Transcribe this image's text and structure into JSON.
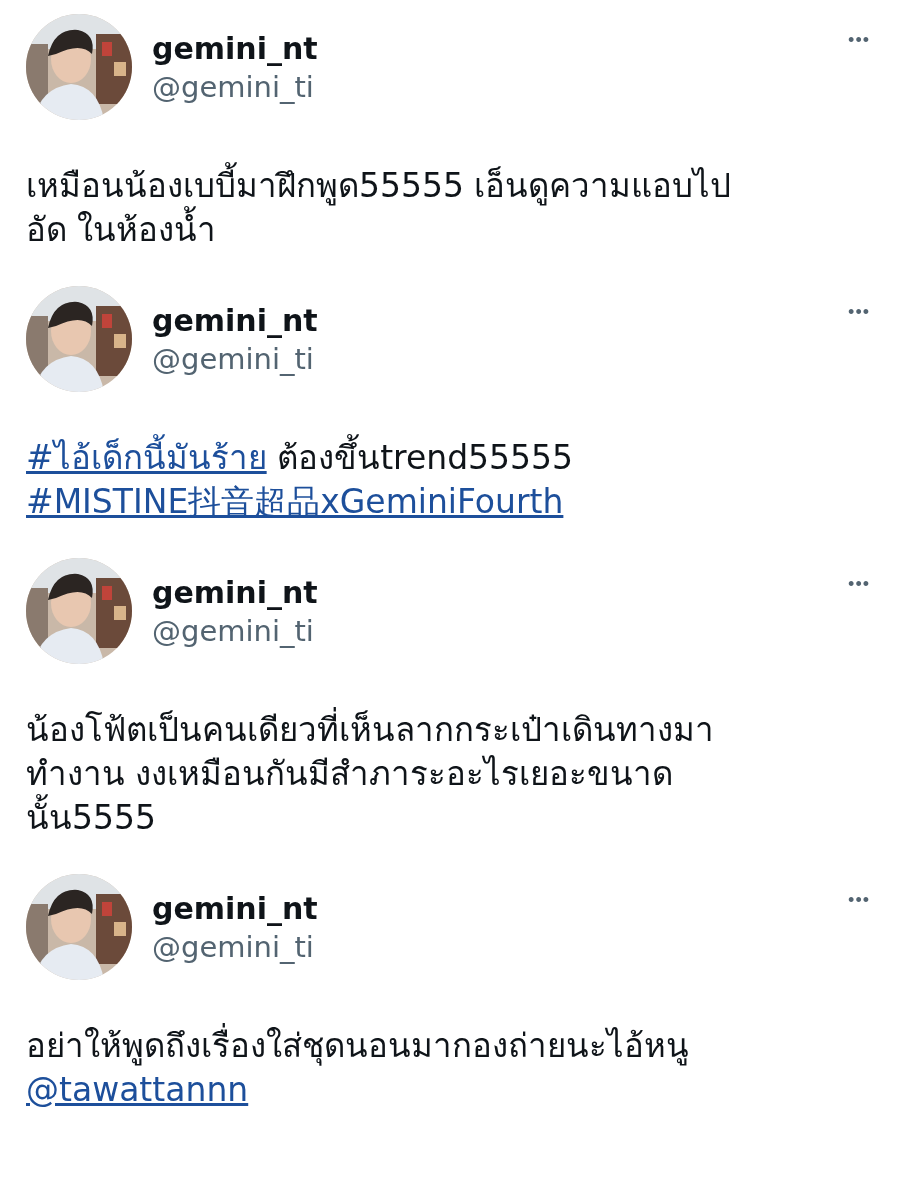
{
  "tweets": [
    {
      "name": "gemini_nt",
      "handle": "@gemini_ti",
      "more": "•••",
      "lines": [
        [
          {
            "kind": "text",
            "text": "เหมือนน้องเบบี้มาฝึกพูด55555 เอ็นดูความแอบไป"
          }
        ],
        [
          {
            "kind": "text",
            "text": "อัด ในห้องน้ำ"
          }
        ]
      ]
    },
    {
      "name": "gemini_nt",
      "handle": "@gemini_ti",
      "more": "•••",
      "lines": [
        [
          {
            "kind": "hashtag",
            "text": "#ไอ้เด็กนี้มันร้าย"
          },
          {
            "kind": "text",
            "text": " ต้องขึ้นtrend55555"
          }
        ],
        [
          {
            "kind": "hashtag",
            "text": "#MISTINE抖音超品xGeminiFourth"
          }
        ]
      ]
    },
    {
      "name": "gemini_nt",
      "handle": "@gemini_ti",
      "more": "•••",
      "lines": [
        [
          {
            "kind": "text",
            "text": "น้องโฟ้ตเป็นคนเดียวที่เห็นลากกระเป๋าเดินทางมา"
          }
        ],
        [
          {
            "kind": "text",
            "text": "ทำงาน งงเหมือนกันมีสำภาระอะไรเยอะขนาด"
          }
        ],
        [
          {
            "kind": "text",
            "text": "นั้น5555"
          }
        ]
      ]
    },
    {
      "name": "gemini_nt",
      "handle": "@gemini_ti",
      "more": "•••",
      "lines": [
        [
          {
            "kind": "text",
            "text": "อย่าให้พูดถึงเรื่องใส่ชุดนอนมากองถ่ายนะไอ้หนู"
          }
        ],
        [
          {
            "kind": "mention",
            "text": "@tawattannn"
          }
        ]
      ]
    }
  ]
}
